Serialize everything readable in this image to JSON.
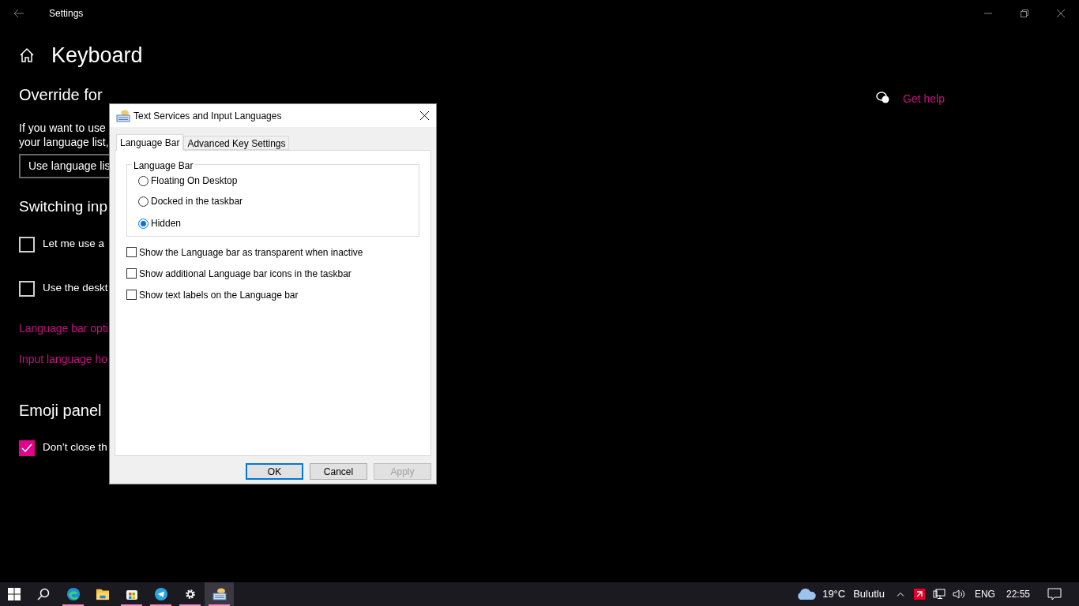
{
  "window": {
    "title": "Settings"
  },
  "page": {
    "title": "Keyboard",
    "help_link": "Get help",
    "sections": [
      {
        "heading": "Override for",
        "paragraph_lines": [
          "If you want to use",
          "your language list,"
        ],
        "dropdown": "Use language lis"
      },
      {
        "heading": "Switching inp",
        "checkboxes": [
          {
            "label": "Let me use a",
            "checked": false
          },
          {
            "label": "Use the deskt",
            "checked": false
          }
        ],
        "links": [
          "Language bar opti",
          "Input language ho"
        ]
      },
      {
        "heading": "Emoji panel",
        "checkboxes": [
          {
            "label": "Don’t close th",
            "checked": true
          }
        ]
      }
    ]
  },
  "dialog": {
    "title": "Text Services and Input Languages",
    "tabs": [
      {
        "label": "Language Bar",
        "selected": true
      },
      {
        "label": "Advanced Key Settings",
        "selected": false
      }
    ],
    "group": {
      "legend": "Language Bar",
      "options": [
        {
          "label": "Floating On Desktop",
          "selected": false
        },
        {
          "label": "Docked in the taskbar",
          "selected": false
        },
        {
          "label": "Hidden",
          "selected": true
        }
      ]
    },
    "checkboxes": [
      {
        "label": "Show the Language bar as transparent when inactive",
        "checked": false
      },
      {
        "label": "Show additional Language bar icons in the taskbar",
        "checked": false
      },
      {
        "label": "Show text labels on the Language bar",
        "checked": false
      }
    ],
    "buttons": [
      {
        "label": "OK",
        "kind": "default",
        "disabled": false
      },
      {
        "label": "Cancel",
        "kind": "normal",
        "disabled": false
      },
      {
        "label": "Apply",
        "kind": "normal",
        "disabled": true
      }
    ]
  },
  "taskbar": {
    "apps": [
      {
        "kind": "edge",
        "open": true,
        "selected": false
      },
      {
        "kind": "folder",
        "open": false,
        "selected": false
      },
      {
        "kind": "store",
        "open": true,
        "selected": false
      },
      {
        "kind": "telegram",
        "open": true,
        "selected": false
      },
      {
        "kind": "gear",
        "open": true,
        "selected": false
      },
      {
        "kind": "keyboard",
        "open": true,
        "selected": true
      }
    ],
    "weather": {
      "temperature": "19°C",
      "condition": "Bulutlu"
    },
    "language": "ENG",
    "time": "22:55"
  }
}
